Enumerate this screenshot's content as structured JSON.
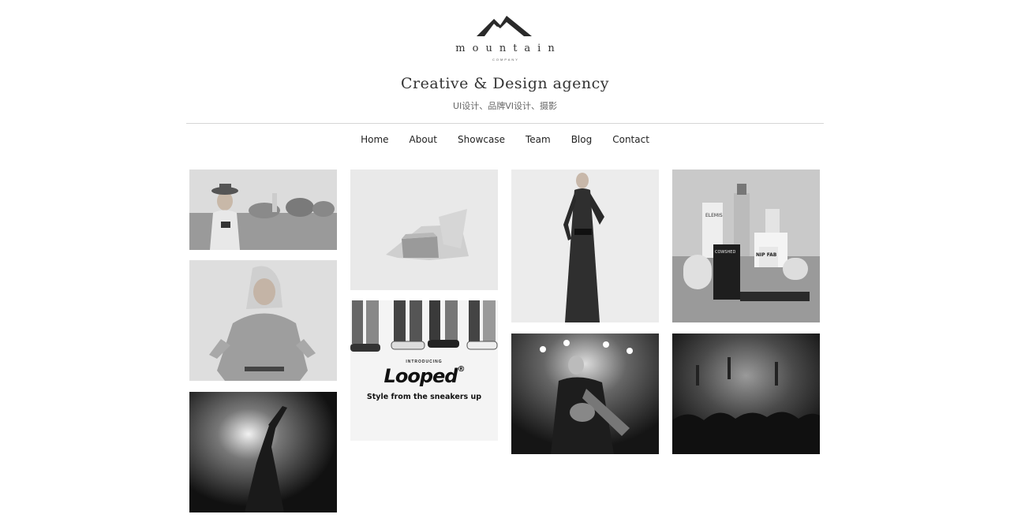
{
  "brand": {
    "logo_icon": "mountain-icon",
    "name": "mountain",
    "sub": "COMPANY"
  },
  "header": {
    "tagline": "Creative & Design agency",
    "subline": "UI设计、品牌VI设计、摄影"
  },
  "nav": {
    "items": [
      {
        "label": "Home"
      },
      {
        "label": "About"
      },
      {
        "label": "Showcase"
      },
      {
        "label": "Team"
      },
      {
        "label": "Blog"
      },
      {
        "label": "Contact"
      }
    ]
  },
  "gallery": {
    "ad": {
      "kicker": "INTRODUCING",
      "brand": "Looped",
      "mark": "®",
      "slogan": "Style from the sneakers up"
    },
    "products": {
      "label_elemis": "ELEMIS",
      "label_cowshed": "COWSHED",
      "label_nip": "NIP FAB"
    }
  },
  "colors": {
    "text": "#222222",
    "divider": "#d6d6d6",
    "background": "#ffffff"
  }
}
